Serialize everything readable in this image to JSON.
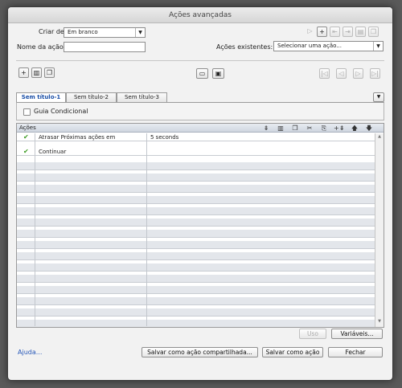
{
  "window": {
    "title": "Ações avançadas"
  },
  "form": {
    "create_label": "Criar de:",
    "create_value": "Em branco",
    "name_label": "Nome da ação:",
    "name_value": "",
    "existing_label": "Ações existentes:",
    "existing_value": "Selecionar uma ação..."
  },
  "toolbar_top": {
    "icons": [
      "play-icon",
      "add-icon",
      "import-icon",
      "export-icon",
      "delete-icon",
      "duplicate-icon"
    ]
  },
  "toolbar_mid": {
    "left_icons": [
      "add-icon",
      "delete-icon",
      "duplicate-icon"
    ],
    "center_icons": [
      "remove-tab-icon",
      "add-tab-icon"
    ],
    "nav_icons": [
      "first-icon",
      "prev-icon",
      "next-icon",
      "last-icon"
    ]
  },
  "tabs": [
    "Sem título-1",
    "Sem título-2",
    "Sem título-3"
  ],
  "conditional": {
    "label": "Guia Condicional"
  },
  "grid": {
    "header": "Ações",
    "icons": [
      "insert-icon",
      "delete-icon",
      "copy-icon",
      "cut-icon",
      "paste-icon",
      "insert-after-icon",
      "move-up-icon",
      "move-down-icon"
    ],
    "rows": [
      {
        "check": "✔",
        "action": "Atrasar Próximas ações em",
        "value": "5   seconds"
      },
      {
        "check": "✔",
        "action": "Continuar",
        "value": ""
      }
    ]
  },
  "buttons": {
    "use": "Uso",
    "variables": "Variáveis...",
    "help": "Ajuda...",
    "save_shared": "Salvar como ação compartilhada...",
    "save": "Salvar como ação",
    "close": "Fechar"
  }
}
